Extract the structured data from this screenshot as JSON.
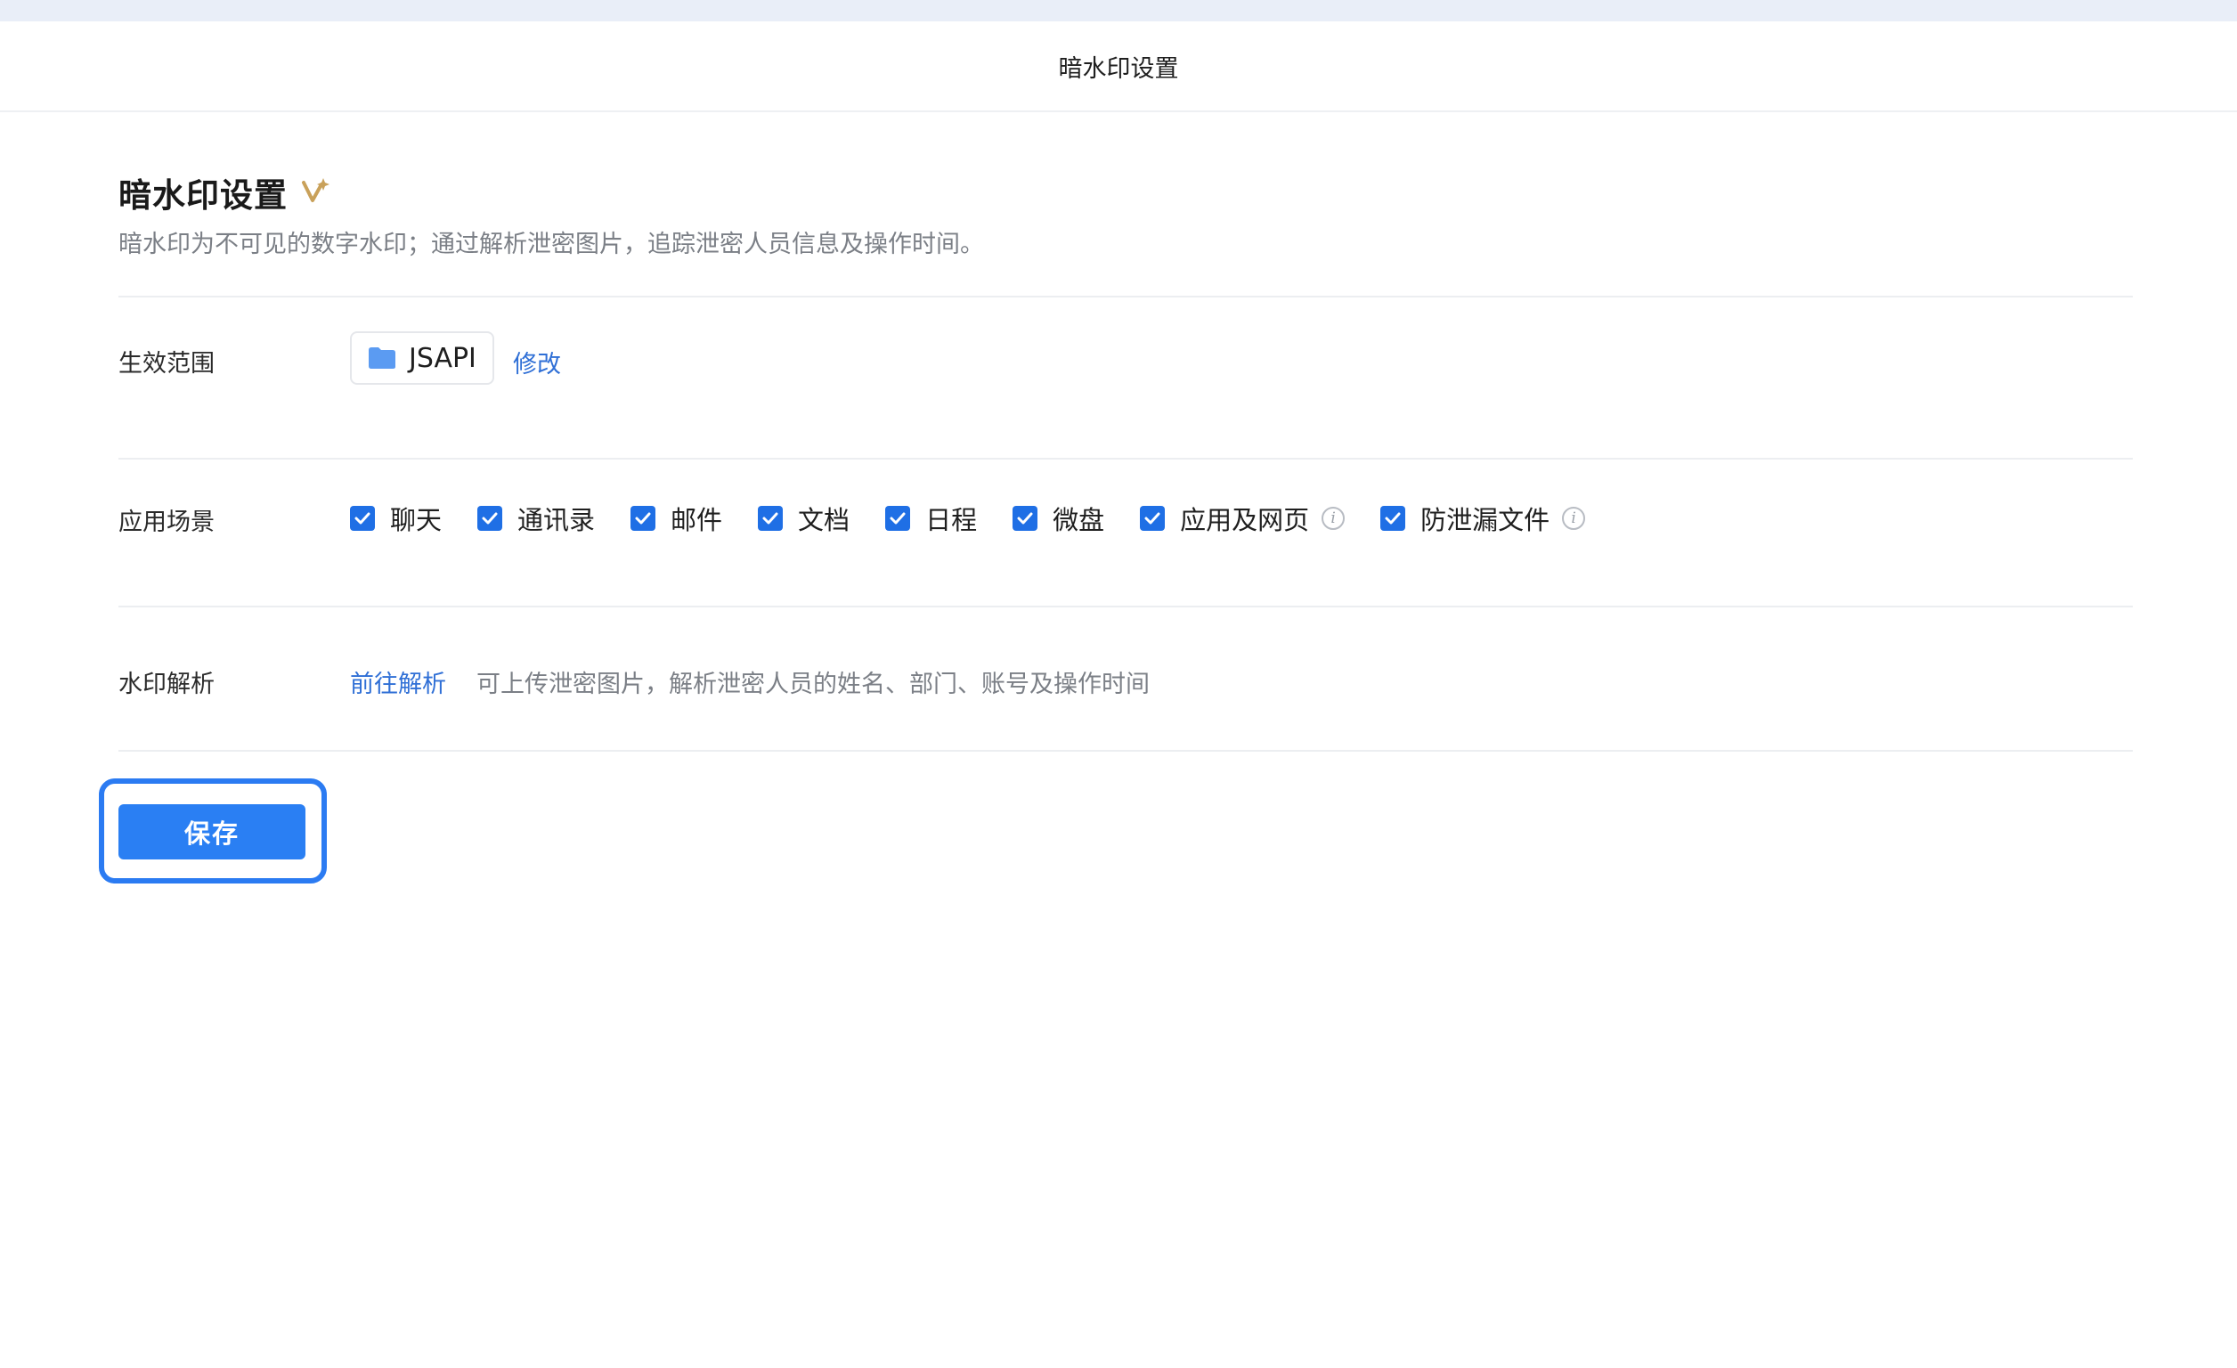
{
  "header": {
    "title": "暗水印设置"
  },
  "page": {
    "title": "暗水印设置",
    "subtitle": "暗水印为不可见的数字水印；通过解析泄密图片，追踪泄密人员信息及操作时间。"
  },
  "scope": {
    "label": "生效范围",
    "chip_text": "JSAPI",
    "modify_label": "修改"
  },
  "scenes": {
    "label": "应用场景",
    "items": [
      {
        "label": "聊天",
        "checked": true
      },
      {
        "label": "通讯录",
        "checked": true
      },
      {
        "label": "邮件",
        "checked": true
      },
      {
        "label": "文档",
        "checked": true
      },
      {
        "label": "日程",
        "checked": true
      },
      {
        "label": "微盘",
        "checked": true
      },
      {
        "label": "应用及网页",
        "checked": true
      },
      {
        "label": "防泄漏文件",
        "checked": true
      }
    ]
  },
  "analysis": {
    "label": "水印解析",
    "link_label": "前往解析",
    "description": "可上传泄密图片，解析泄密人员的姓名、部门、账号及操作时间"
  },
  "actions": {
    "save_label": "保存"
  },
  "icons": {
    "sparkle": "sparkle-icon",
    "folder": "folder-icon",
    "check": "check-icon",
    "info": "info-icon"
  },
  "colors": {
    "accent": "#2a7ff3",
    "link": "#2f6fd6",
    "checkbox": "#1f6fe5",
    "folder": "#5b9bf2",
    "sparkle": "#c9a15a"
  }
}
